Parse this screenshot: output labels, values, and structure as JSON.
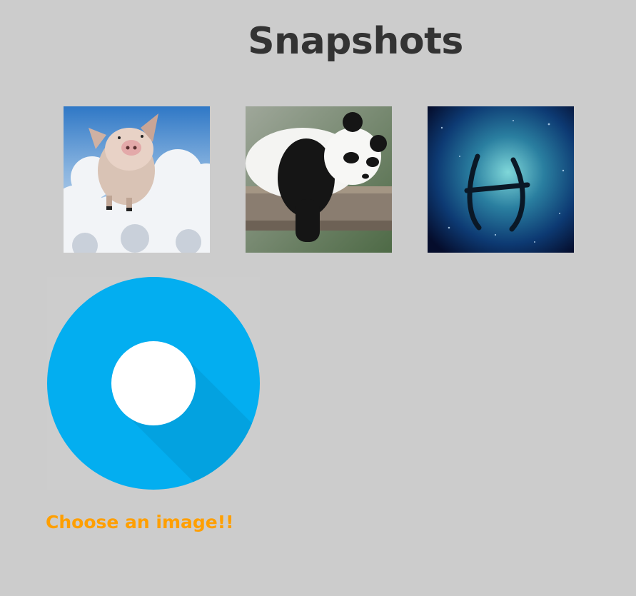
{
  "page": {
    "title": "Snapshots",
    "prompt": "Choose an image!!"
  },
  "gallery": {
    "items": [
      {
        "subject": "flying pig among clouds"
      },
      {
        "subject": "panda sleeping on log"
      },
      {
        "subject": "pisces zodiac symbol"
      }
    ]
  },
  "upload": {
    "icon": "upload-circle-icon"
  },
  "colors": {
    "background": "#cccccc",
    "title": "#333333",
    "accent": "#03aef0",
    "prompt": "#ff9f00"
  }
}
